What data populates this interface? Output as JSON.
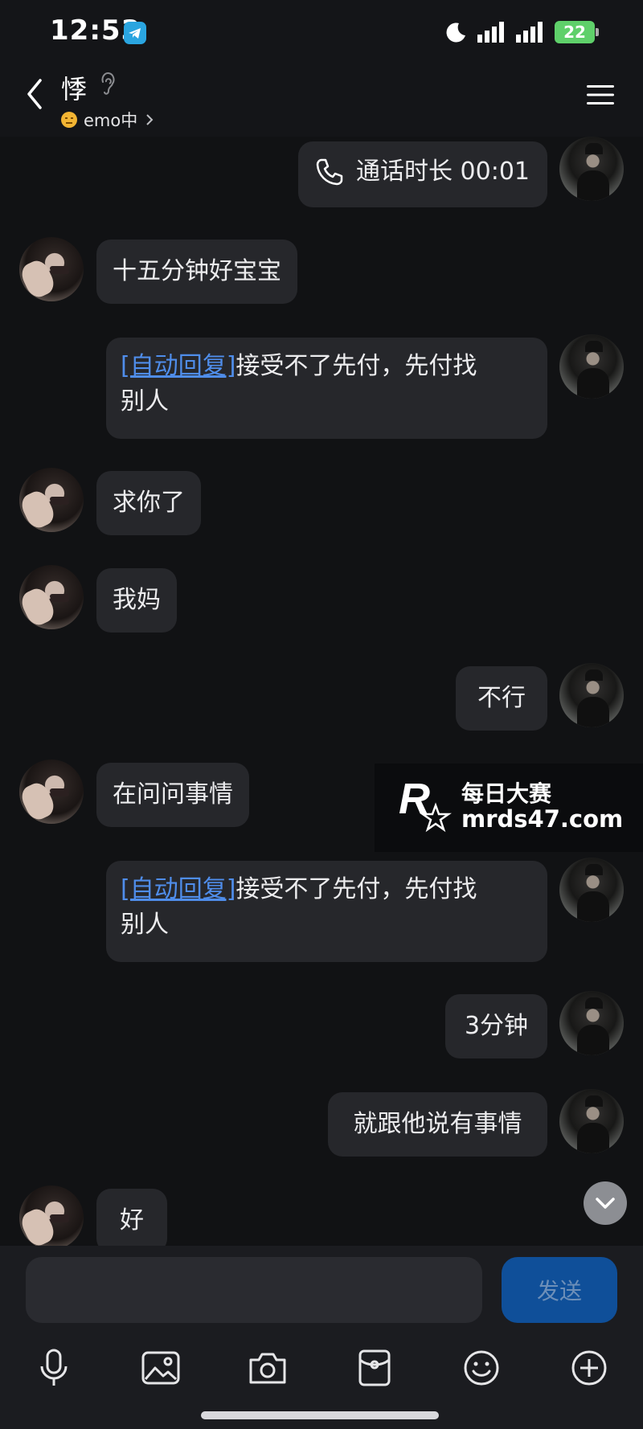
{
  "status_bar": {
    "time": "12:53",
    "battery": "22"
  },
  "header": {
    "contact_name": "悸",
    "mood": "emo中"
  },
  "messages": [
    {
      "side": "right",
      "type": "call",
      "text": "通话时长 00:01"
    },
    {
      "side": "left",
      "text": "十五分钟好宝宝"
    },
    {
      "side": "right",
      "auto_tag": "[自动回复]",
      "text_line1": "接受不了先付，先付找",
      "text_line2": "别人"
    },
    {
      "side": "left",
      "text": "求你了"
    },
    {
      "side": "left",
      "text": "我妈"
    },
    {
      "side": "right",
      "text": "不行"
    },
    {
      "side": "left",
      "text": "在问问事情"
    },
    {
      "side": "right",
      "auto_tag": "[自动回复]",
      "text_line1": "接受不了先付，先付找",
      "text_line2": "别人"
    },
    {
      "side": "right",
      "text": "3分钟"
    },
    {
      "side": "right",
      "text": "就跟他说有事情"
    },
    {
      "side": "left",
      "text": "好"
    }
  ],
  "watermark": {
    "title": "每日大赛",
    "url": "mrds47.com"
  },
  "input": {
    "placeholder": "",
    "send_label": "发送"
  },
  "toolbar_icons": [
    "microphone-icon",
    "image-icon",
    "camera-icon",
    "red-packet-icon",
    "emoji-icon",
    "plus-icon"
  ]
}
